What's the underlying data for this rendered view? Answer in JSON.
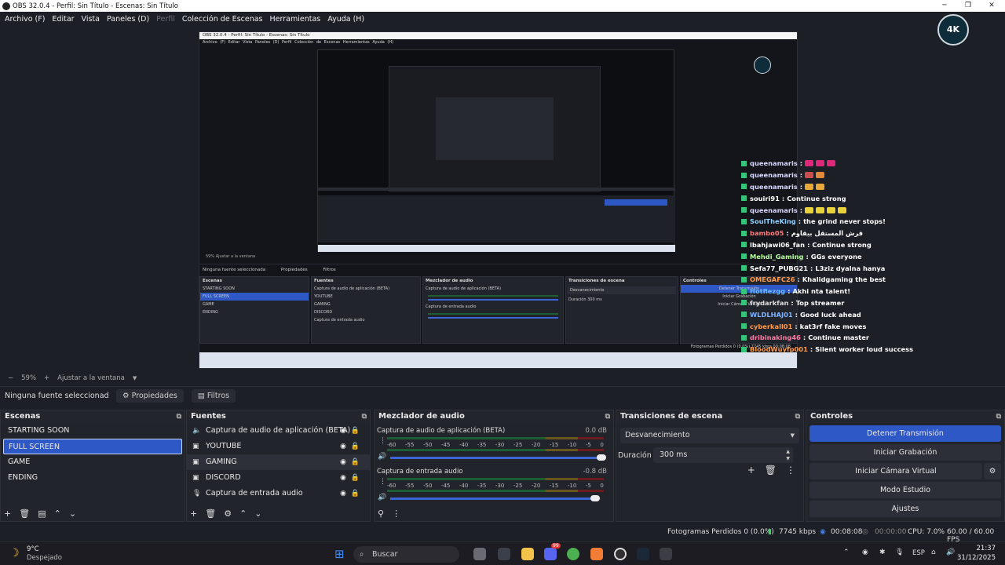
{
  "window": {
    "title": "OBS 32.0.4 - Perfil: Sin Título - Escenas: Sin Título"
  },
  "menu": [
    "Archivo (F)",
    "Editar",
    "Vista",
    "Paneles (D)",
    "Perfil",
    "Colección de Escenas",
    "Herramientas",
    "Ayuda (H)"
  ],
  "preview": {
    "nested_title": "OBS 32.0.4 - Perfil: Sin Título - Escenas: Sin Título",
    "nested_menu": "Archivo (F)  Editar  Vista  Paneles (D)  Perfil  Colección de Escenas  Herramientas  Ayuda (H)",
    "nested_zoom": "59%   Ajustar a la ventana",
    "nested_no_source": "Ninguna fuente seleccionada",
    "nested_props": "Propiedades",
    "nested_filters": "Filtros",
    "nested_heads": [
      "Escenas",
      "Fuentes",
      "Mezclador de audio",
      "Transiciones de escena",
      "Controles"
    ],
    "logo_text": "4K"
  },
  "chat": [
    {
      "name": "queenamaris",
      "msg": "",
      "color": "#d7d7ff",
      "emotes": [
        "#e0287a",
        "#e0287a",
        "#e0287a"
      ]
    },
    {
      "name": "queenamaris",
      "msg": "",
      "color": "#d7d7ff",
      "emotes": [
        "#c94f4f",
        "#e2883a"
      ]
    },
    {
      "name": "queenamaris",
      "msg": "",
      "color": "#d7d7ff",
      "emotes": [
        "#e8a83a",
        "#e8a83a"
      ]
    },
    {
      "name": "souiri91",
      "msg": "Continue strong",
      "color": "#ffffff",
      "emotes": []
    },
    {
      "name": "queenamaris",
      "msg": "",
      "color": "#d7d7ff",
      "emotes": [
        "#e8d23a",
        "#e8d23a",
        "#e8d23a",
        "#e8d23a"
      ]
    },
    {
      "name": "SoulTheKing",
      "msg": "the grind never stops!",
      "color": "#8fd0ff",
      "emotes": []
    },
    {
      "name": "bambo05",
      "msg": "قرش المستقل بيقاوم",
      "color": "#ff7a7a",
      "emotes": []
    },
    {
      "name": "lbahjawi06_fan",
      "msg": "Continue strong",
      "color": "#ffffff",
      "emotes": []
    },
    {
      "name": "Mehdi_Gaming",
      "msg": "GGs everyone",
      "color": "#b6ff9c",
      "emotes": []
    },
    {
      "name": "Sefa77_PUBG21",
      "msg": "L3ziz dyalna hanya",
      "color": "#ffffff",
      "emotes": []
    },
    {
      "name": "OMEGAFC26",
      "msg": "Khalidgaming the best",
      "color": "#ff9b4a",
      "emotes": []
    },
    {
      "name": "Hotfiezgg",
      "msg": "Akhi nta talent!",
      "color": "#6ab8ff",
      "emotes": []
    },
    {
      "name": "frydarkfan",
      "msg": "Top streamer",
      "color": "#dddddd",
      "emotes": []
    },
    {
      "name": "WLDLHAJ01",
      "msg": "Good luck ahead",
      "color": "#7fb3ff",
      "emotes": []
    },
    {
      "name": "cyberkall01",
      "msg": "kat3rf fake moves",
      "color": "#ff9b4a",
      "emotes": []
    },
    {
      "name": "dribinaking46",
      "msg": "Continue master",
      "color": "#ff7aa2",
      "emotes": []
    },
    {
      "name": "BloodWuyfp001",
      "msg": "Silent worker loud success",
      "color": "#ff9b4a",
      "emotes": []
    }
  ],
  "zoom": {
    "value": "59%",
    "fit_label": "Ajustar a la ventana"
  },
  "context": {
    "no_source": "Ninguna fuente seleccionada",
    "properties": "Propiedades",
    "filters": "Filtros"
  },
  "scenes": {
    "title": "Escenas",
    "items": [
      "STARTING SOON",
      "FULL SCREEN",
      "GAME",
      "ENDING"
    ],
    "selected_index": 1
  },
  "sources": {
    "title": "Fuentes",
    "items": [
      {
        "label": "Captura de audio de aplicación (BETA)",
        "icon": "speaker-icon"
      },
      {
        "label": "YOUTUBE",
        "icon": "browser-icon"
      },
      {
        "label": "GAMING",
        "icon": "browser-icon"
      },
      {
        "label": "DISCORD",
        "icon": "browser-icon"
      },
      {
        "label": "Captura de entrada audio",
        "icon": "microphone-icon"
      }
    ]
  },
  "mixer": {
    "title": "Mezclador de audio",
    "ticks": [
      "-60",
      "-55",
      "-50",
      "-45",
      "-40",
      "-35",
      "-30",
      "-25",
      "-20",
      "-15",
      "-10",
      "-5",
      "0"
    ],
    "channels": [
      {
        "name": "Captura de audio de aplicación (BETA)",
        "db": "0.0 dB",
        "volume": 1.0
      },
      {
        "name": "Captura de entrada audio",
        "db": "-0.8 dB",
        "volume": 0.97
      }
    ]
  },
  "transitions": {
    "title": "Transiciones de escena",
    "selected": "Desvanecimiento",
    "duration_label": "Duración",
    "duration": "300 ms"
  },
  "controls": {
    "title": "Controles",
    "buttons": [
      "Detener Transmisión",
      "Iniciar Grabación",
      "Iniciar Cámara Virtual",
      "Modo Estudio",
      "Ajustes"
    ]
  },
  "status": {
    "dropped": "Fotogramas Perdidos 0 (0.0%)",
    "bitrate": "7745 kbps",
    "stream_time": "00:08:08",
    "rec_time": "00:00:00",
    "cpu": "CPU: 7.0%",
    "fps": "60.00 / 60.00 FPS"
  },
  "taskbar": {
    "weather_temp": "9°C",
    "weather_desc": "Despejado",
    "search": "Buscar",
    "lang": "ESP",
    "time": "21:37",
    "date": "31/12/2025",
    "notif_badge": "99"
  }
}
